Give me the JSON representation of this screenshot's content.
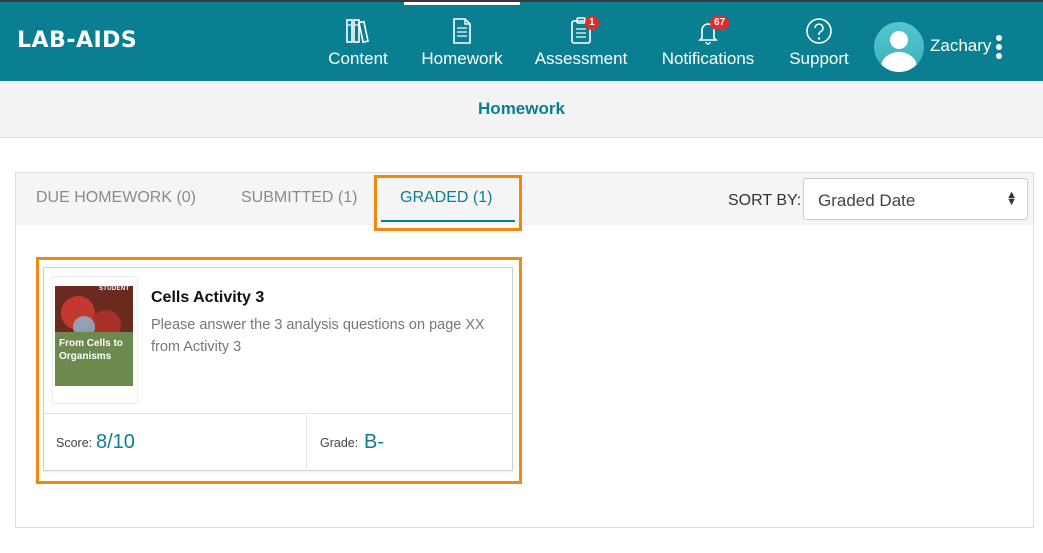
{
  "brand": {
    "logo_text": "LAB-AIDS"
  },
  "nav": {
    "items": [
      {
        "label": "Content",
        "icon": "books-icon"
      },
      {
        "label": "Homework",
        "icon": "document-icon",
        "active": true
      },
      {
        "label": "Assessment",
        "icon": "clipboard-icon",
        "badge": "1"
      },
      {
        "label": "Notifications",
        "icon": "bell-icon",
        "badge": "67"
      },
      {
        "label": "Support",
        "icon": "question-circle-icon"
      }
    ]
  },
  "user": {
    "name": "Zachary"
  },
  "page": {
    "title": "Homework"
  },
  "tabs": [
    {
      "label": "DUE HOMEWORK (0)"
    },
    {
      "label": "SUBMITTED (1)"
    },
    {
      "label": "GRADED (1)",
      "active": true
    }
  ],
  "sort": {
    "label": "SORT BY:",
    "value": "Graded Date"
  },
  "cards": [
    {
      "cover_badge": "STUDENT",
      "cover_title": "From Cells to Organisms",
      "title": "Cells Activity 3",
      "description": "Please answer the 3 analysis questions on page XX from Activity 3",
      "score_label": "Score:",
      "score": "8/10",
      "grade_label": "Grade:",
      "grade": "B-"
    }
  ],
  "colors": {
    "primary": "#0b7f92",
    "highlight": "#f0890e",
    "badge": "#e32b2b"
  }
}
